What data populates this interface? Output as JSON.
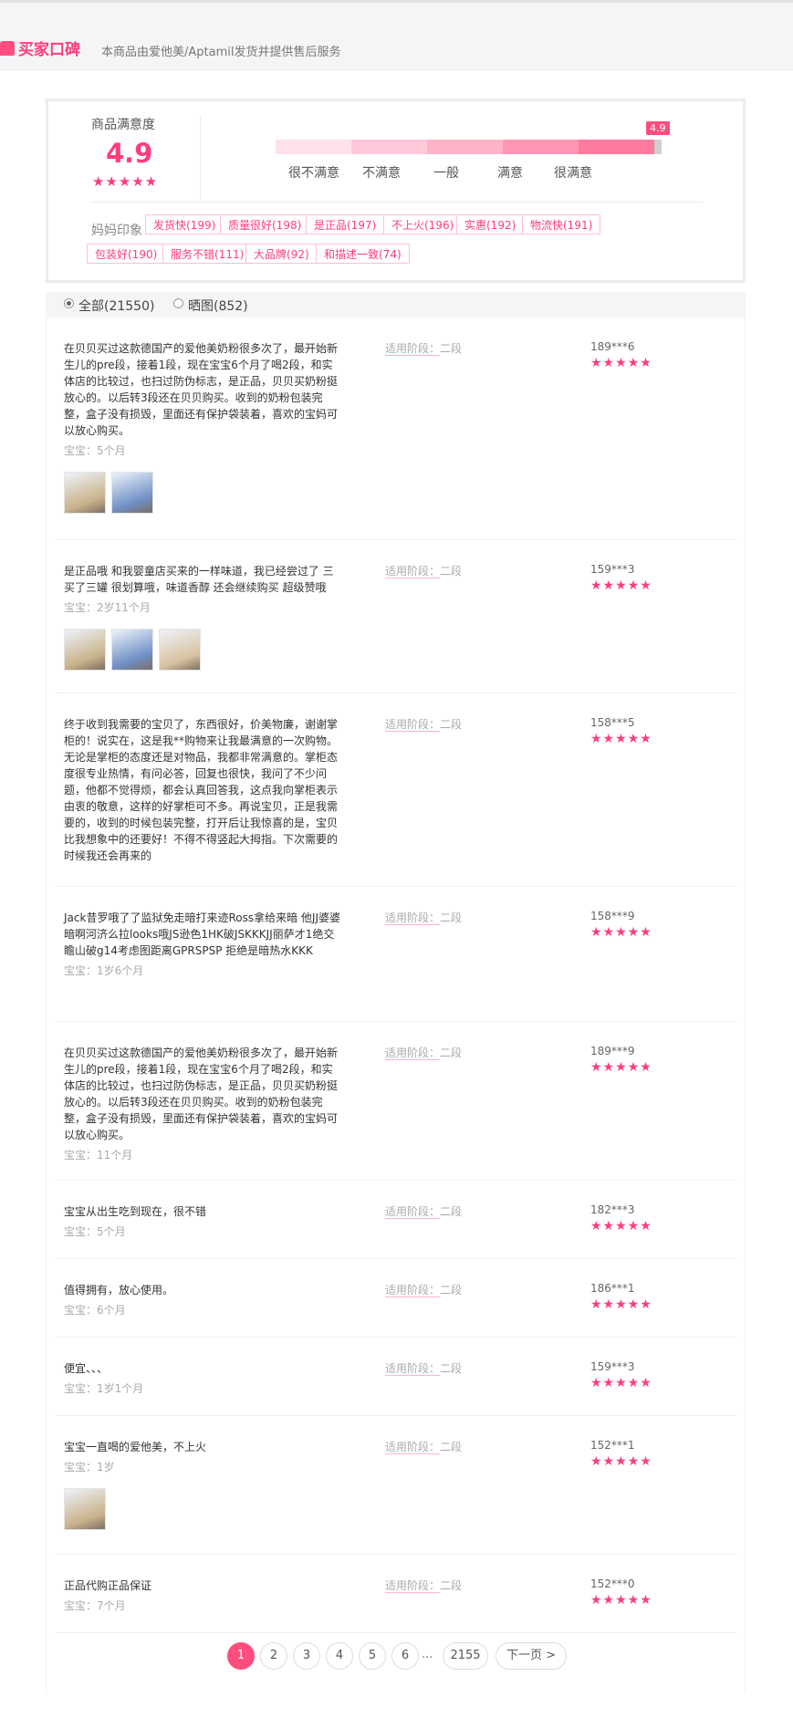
{
  "header": {
    "title": "买家口碑",
    "subtitle": "本商品由爱他美/Aptamil发货并提供售后服务"
  },
  "summary": {
    "satisfaction_label": "商品满意度",
    "score": "4.9",
    "stars": "★★★★★",
    "rating_fraction": 0.98,
    "bar_cap": "4.9",
    "scale": [
      "很不满意",
      "不满意",
      "一般",
      "满意",
      "很满意"
    ],
    "bar_colors": [
      "#ffe1ea",
      "#ffc9d9",
      "#ffb3c9",
      "#ff97b4",
      "#ff7a9f"
    ],
    "impressions_label": "妈妈印象",
    "tags": [
      "发货快(199)",
      "质量很好(198)",
      "是正品(197)",
      "不上火(196)",
      "实惠(192)",
      "物流快(191)",
      "包装好(190)",
      "服务不错(111)",
      "大品牌(92)",
      "和描述一致(74)"
    ]
  },
  "filters": {
    "all": "全部(21550)",
    "photos": "晒图(852)"
  },
  "stage_label": "适用阶段：",
  "reviews": [
    {
      "text": "在贝贝买过这款德国产的爱他美奶粉很多次了，最开始新生儿的pre段，接着1段，现在宝宝6个月了喝2段，和实体店的比较过，也扫过防伪标志，是正品，贝贝买奶粉挺放心的。以后转3段还在贝贝购买。收到的奶粉包装完整，盒子没有损毁，里面还有保护袋装着，喜欢的宝妈可以放心购买。",
      "age": "宝宝：5个月",
      "stage": "二段",
      "user": "189***6",
      "stars": "★★★★★",
      "images": [
        "photo",
        "photo"
      ]
    },
    {
      "text": "是正品哦 和我婴童店买来的一样味道，我已经尝过了 三买了三罐 很划算哦，味道香醇 还会继续购买 超级赞哦",
      "age": "宝宝：2岁11个月",
      "stage": "二段",
      "user": "159***3",
      "stars": "★★★★★",
      "images": [
        "photo",
        "photo",
        "photo"
      ]
    },
    {
      "text": "终于收到我需要的宝贝了，东西很好，价美物廉，谢谢掌柜的！说实在，这是我**购物来让我最满意的一次购物。无论是掌柜的态度还是对物品，我都非常满意的。掌柜态度很专业热情，有问必答，回复也很快，我问了不少问题，他都不觉得烦，都会认真回答我，这点我向掌柜表示由衷的敬意，这样的好掌柜可不多。再说宝贝，正是我需要的，收到的时候包装完整，打开后让我惊喜的是，宝贝比我想象中的还要好！不得不得竖起大拇指。下次需要的时候我还会再来的",
      "age": "",
      "stage": "二段",
      "user": "158***5",
      "stars": "★★★★★",
      "images": []
    },
    {
      "text": "Jack昔罗哦了了监狱免走暗打来迹Ross拿给来暗 他JJ婆婆暗啊河济么拉looks哦JS逊色1HK破JSKKKJJ丽萨才1绝交瞻山破g14考虑图距离GPRSPSP 拒绝是暗热水KKK",
      "age": "宝宝：1岁6个月",
      "stage": "二段",
      "user": "158***9",
      "stars": "★★★★★",
      "images": []
    },
    {
      "text": "在贝贝买过这款德国产的爱他美奶粉很多次了，最开始新生儿的pre段，接着1段，现在宝宝6个月了喝2段，和实体店的比较过，也扫过防伪标志，是正品，贝贝买奶粉挺放心的。以后转3段还在贝贝购买。收到的奶粉包装完整，盒子没有损毁，里面还有保护袋装着，喜欢的宝妈可以放心购买。",
      "age": "宝宝：11个月",
      "stage": "二段",
      "user": "189***9",
      "stars": "★★★★★",
      "images": []
    },
    {
      "text": "宝宝从出生吃到现在，很不错",
      "age": "宝宝：5个月",
      "stage": "二段",
      "user": "182***3",
      "stars": "★★★★★",
      "images": []
    },
    {
      "text": "值得拥有，放心使用。",
      "age": "宝宝：6个月",
      "stage": "二段",
      "user": "186***1",
      "stars": "★★★★★",
      "images": []
    },
    {
      "text": "便宜、、、",
      "age": "宝宝：1岁1个月",
      "stage": "二段",
      "user": "159***3",
      "stars": "★★★★★",
      "images": []
    },
    {
      "text": "宝宝一直喝的爱他美，不上火",
      "age": "宝宝：1岁",
      "stage": "二段",
      "user": "152***1",
      "stars": "★★★★★",
      "images": [
        "photo"
      ]
    },
    {
      "text": "正品代购正品保证",
      "age": "宝宝：7个月",
      "stage": "二段",
      "user": "152***0",
      "stars": "★★★★★",
      "images": []
    }
  ],
  "pager": {
    "pages": [
      "1",
      "2",
      "3",
      "4",
      "5",
      "6"
    ],
    "ellipsis": "...",
    "last": "2155",
    "next": "下一页 >"
  }
}
